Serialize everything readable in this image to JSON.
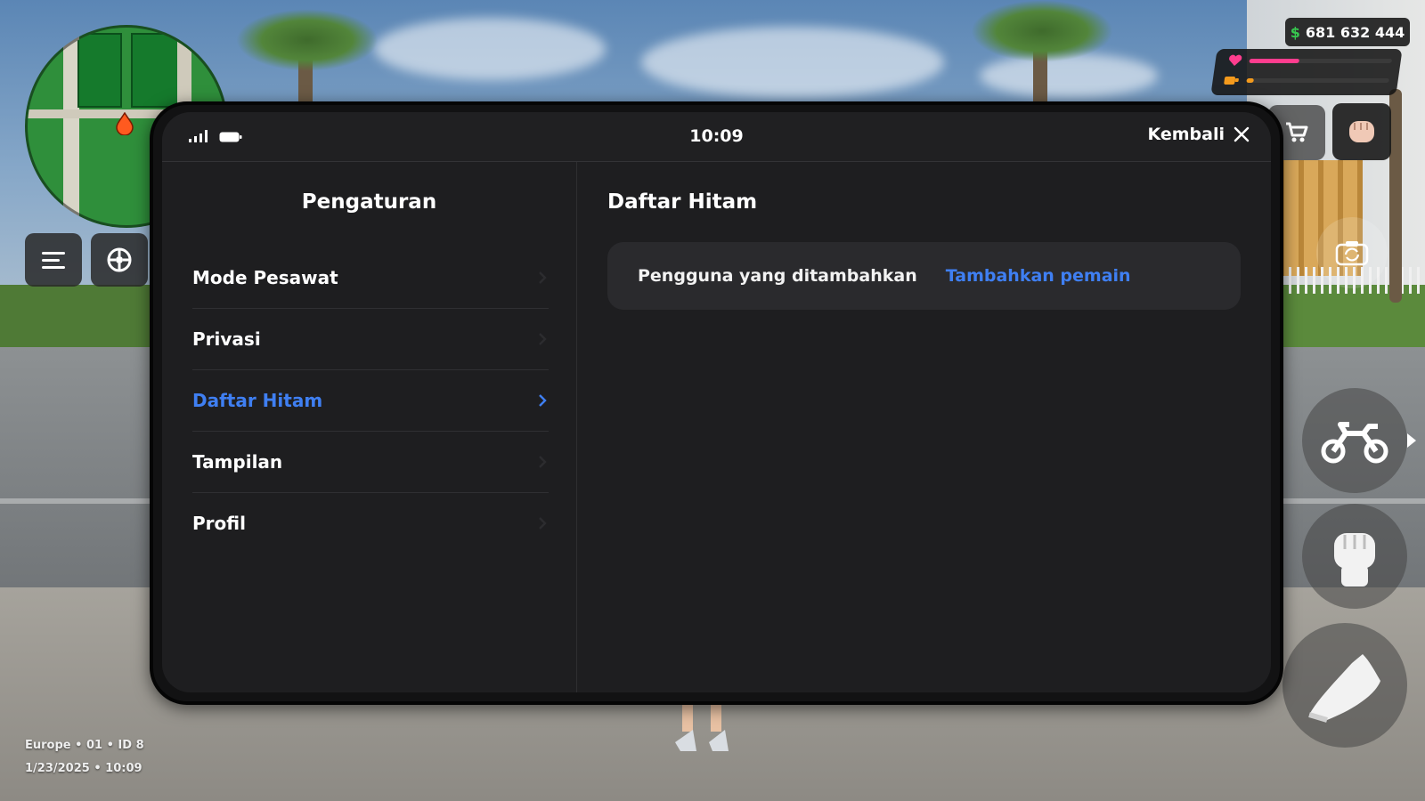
{
  "hud": {
    "currency_symbol": "$",
    "money": "681 632 444",
    "health_fraction": 0.35,
    "hunger_fraction": 0.05,
    "health_color": "#ff3d8e",
    "hunger_color": "#f39a1d",
    "server_line": "Europe • 01 • ID 8",
    "datetime_line": "1/23/2025 • 10:09"
  },
  "phone": {
    "time": "10:09",
    "close_label": "Kembali",
    "sidebar": {
      "title": "Pengaturan",
      "items": [
        {
          "label": "Mode Pesawat",
          "active": false
        },
        {
          "label": "Privasi",
          "active": false
        },
        {
          "label": "Daftar Hitam",
          "active": true
        },
        {
          "label": "Tampilan",
          "active": false
        },
        {
          "label": "Profil",
          "active": false
        }
      ]
    },
    "content": {
      "title": "Daftar Hitam",
      "row_label": "Pengguna yang ditambahkan",
      "row_action": "Tambahkan pemain"
    }
  },
  "colors": {
    "accent": "#3f7ff2",
    "money_green": "#37c84f"
  }
}
